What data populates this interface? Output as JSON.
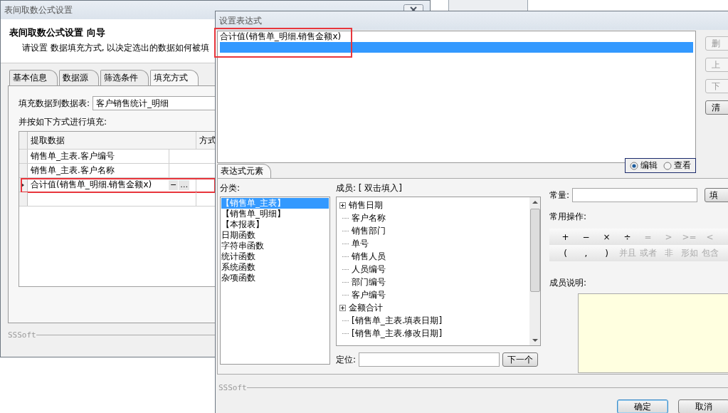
{
  "back_dialog": {
    "title": "表间取数公式设置",
    "heading": "表间取数公式设置  向导",
    "instruction": "请设置  数据填充方式, 以决定选出的数据如何被填",
    "tabs": [
      {
        "label": "基本信息",
        "selected": false
      },
      {
        "label": "数据源",
        "selected": false
      },
      {
        "label": "筛选条件",
        "selected": false
      },
      {
        "label": "填充方式",
        "selected": true
      }
    ],
    "target_label": "填充数据到数据表:",
    "target_value": "客户销售统计_明细",
    "fill_label": "并按如下方式进行填充:",
    "grid": {
      "columns": [
        "提取数据",
        "方式"
      ],
      "rows": [
        {
          "text": "销售单_主表.客户编号",
          "selected": false,
          "highlighted": false
        },
        {
          "text": "销售单_主表.客户名称",
          "selected": false,
          "highlighted": false
        },
        {
          "text": "合计值(销售单_明细.销售金额x)",
          "selected": true,
          "highlighted": true
        }
      ],
      "editor_buttons": [
        "−",
        "…"
      ]
    },
    "footer": "SSSoft"
  },
  "expression_dialog": {
    "title": "设置表达式",
    "expression_lines": [
      {
        "text": "合计值(销售单_明细.销售金额x)",
        "selected": false
      },
      {
        "selected": true
      }
    ],
    "highlighted": true,
    "side_buttons": [
      "删",
      "上",
      "下",
      "清"
    ],
    "tab": "表达式元素",
    "modes": [
      {
        "label": "编辑",
        "selected": true
      },
      {
        "label": "查看",
        "selected": false
      }
    ],
    "category_label": "分类:",
    "categories": [
      {
        "label": "【销售单_主表】",
        "selected": true
      },
      {
        "label": "【销售单_明细】",
        "selected": false
      },
      {
        "label": "【本报表】",
        "selected": false
      },
      {
        "label": "日期函数",
        "selected": false
      },
      {
        "label": "字符串函数",
        "selected": false
      },
      {
        "label": "统计函数",
        "selected": false
      },
      {
        "label": "系统函数",
        "selected": false
      },
      {
        "label": "杂项函数",
        "selected": false
      }
    ],
    "member_label": "成员: [ 双击填入]",
    "members": [
      {
        "label": "销售日期",
        "expandable": true
      },
      {
        "label": "客户名称",
        "expandable": false
      },
      {
        "label": "销售部门",
        "expandable": false
      },
      {
        "label": "单号",
        "expandable": false
      },
      {
        "label": "销售人员",
        "expandable": false
      },
      {
        "label": "人员编号",
        "expandable": false
      },
      {
        "label": "部门编号",
        "expandable": false
      },
      {
        "label": "客户编号",
        "expandable": false
      },
      {
        "label": "金额合计",
        "expandable": true
      },
      {
        "label": "[销售单_主表.填表日期]",
        "expandable": false
      },
      {
        "label": "[销售单_主表.修改日期]",
        "expandable": false
      }
    ],
    "locate_label": "定位:",
    "next_button": "下一个",
    "constant_label": "常量:",
    "constant_button": "填",
    "operations_label": "常用操作:",
    "operations": [
      [
        {
          "label": "+",
          "disabled": false
        },
        {
          "label": "−",
          "disabled": false
        },
        {
          "label": "×",
          "disabled": false
        },
        {
          "label": "÷",
          "disabled": false
        },
        {
          "label": "=",
          "disabled": true
        },
        {
          "label": ">",
          "disabled": true
        },
        {
          "label": ">=",
          "disabled": true
        },
        {
          "label": "<",
          "disabled": true
        }
      ],
      [
        {
          "label": "(",
          "disabled": false
        },
        {
          "label": ",",
          "disabled": false
        },
        {
          "label": ")",
          "disabled": false
        },
        {
          "label": "并且",
          "disabled": true
        },
        {
          "label": "或者",
          "disabled": true
        },
        {
          "label": "非",
          "disabled": true
        },
        {
          "label": "形如",
          "disabled": true
        },
        {
          "label": "包含",
          "disabled": true
        }
      ]
    ],
    "description_label": "成员说明:",
    "footer": "SSSoft",
    "buttons": [
      {
        "label": "确定",
        "default": true
      },
      {
        "label": "取消",
        "default": false
      }
    ]
  }
}
